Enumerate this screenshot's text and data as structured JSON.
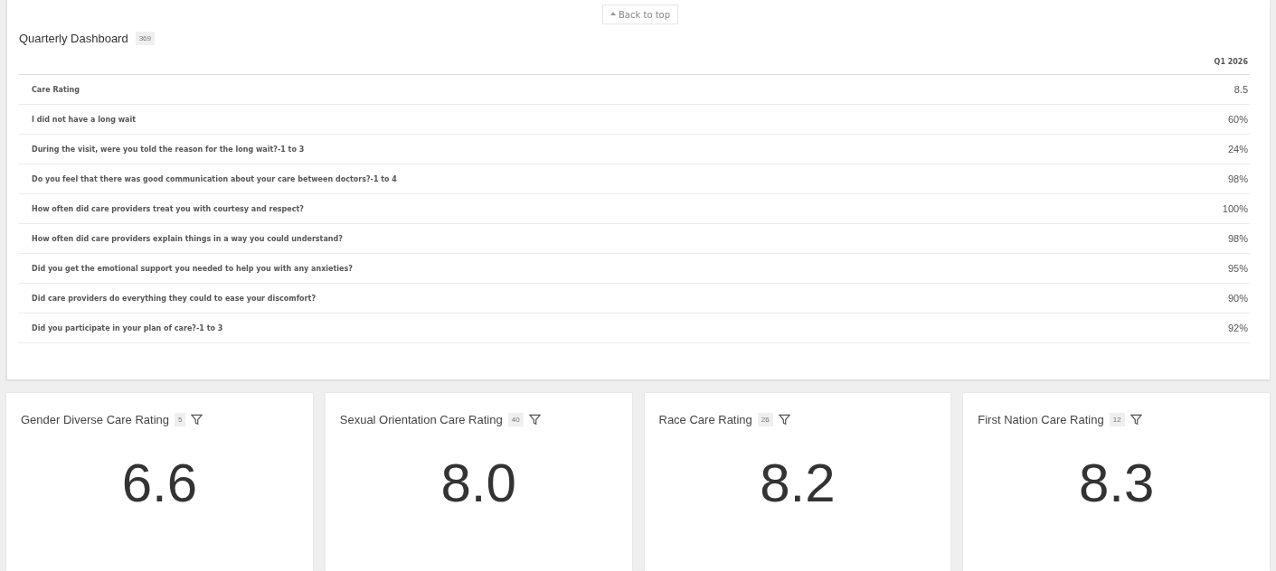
{
  "back_to_top": {
    "label": "Back to top"
  },
  "dashboard": {
    "title": "Quarterly Dashboard",
    "count": "369",
    "column": "Q1 2026",
    "rows": [
      {
        "label": "Care Rating",
        "value": "8.5"
      },
      {
        "label": "I did not have a long wait",
        "value": "60%"
      },
      {
        "label": "During the visit, were you told the reason for the long wait?-1 to 3",
        "value": "24%"
      },
      {
        "label": "Do you feel that there was good communication about your care between doctors?-1 to 4",
        "value": "98%"
      },
      {
        "label": "How often did care providers treat you with courtesy and respect?",
        "value": "100%"
      },
      {
        "label": "How often did care providers explain things in a way you could understand?",
        "value": "98%"
      },
      {
        "label": "Did you get the emotional support you needed to help you with any anxieties?",
        "value": "95%"
      },
      {
        "label": "Did care providers do everything they could to ease your discomfort?",
        "value": "90%"
      },
      {
        "label": "Did you participate in your plan of care?-1 to 3",
        "value": "92%"
      }
    ]
  },
  "cards": [
    {
      "title": "Gender Diverse Care Rating",
      "count": "5",
      "value": "6.6"
    },
    {
      "title": "Sexual Orientation Care Rating",
      "count": "40",
      "value": "8.0"
    },
    {
      "title": "Race Care Rating",
      "count": "26",
      "value": "8.2"
    },
    {
      "title": "First Nation Care Rating",
      "count": "12",
      "value": "8.3"
    }
  ]
}
